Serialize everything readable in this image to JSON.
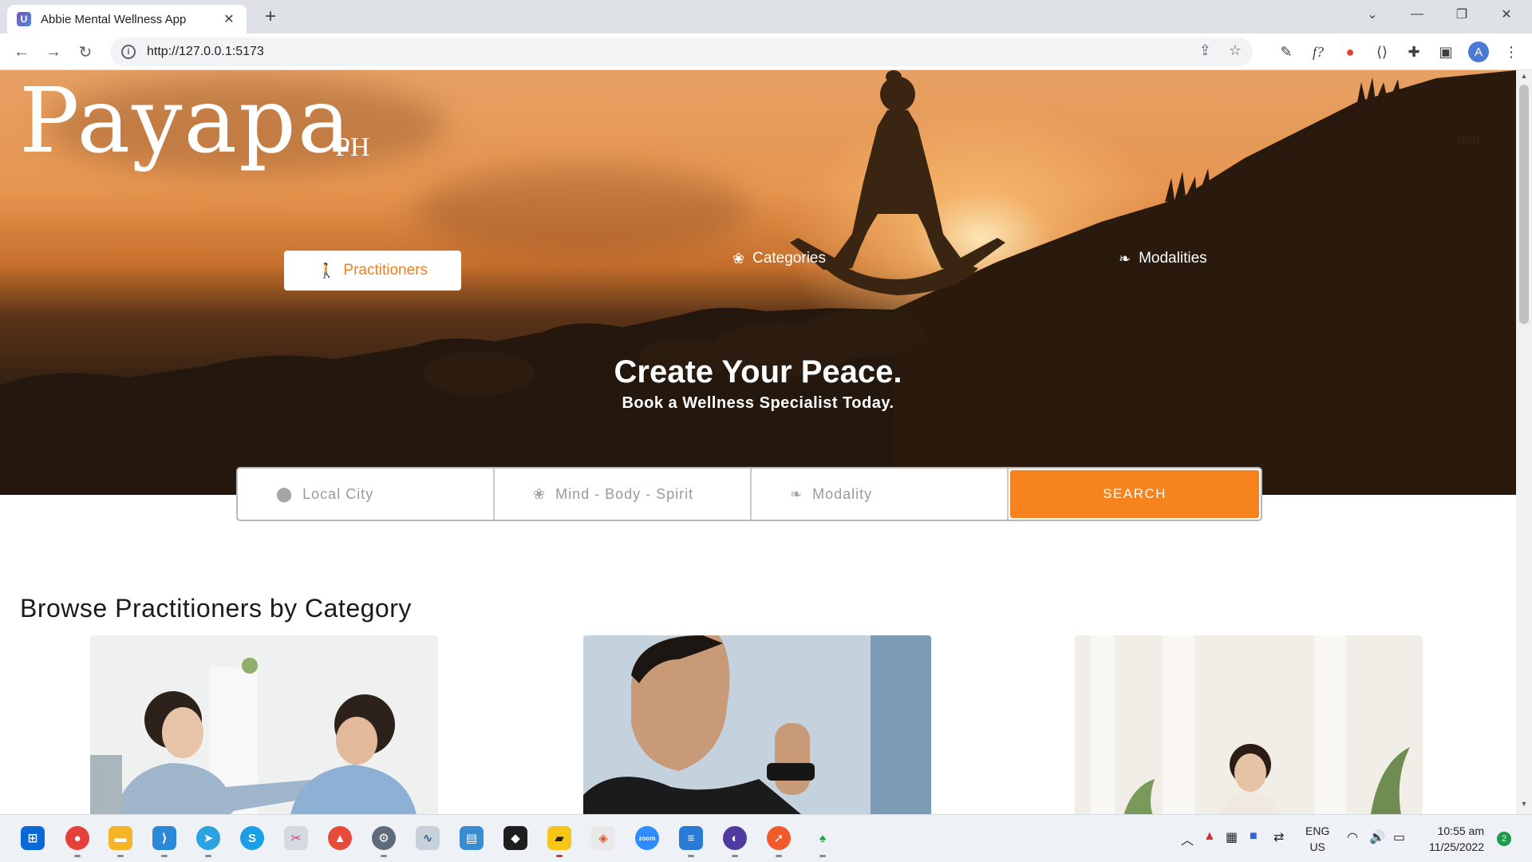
{
  "browser": {
    "tab_title": "Abbie Mental Wellness App",
    "favicon_letter": "U",
    "url": "http://127.0.0.1:5173",
    "profile_initial": "A",
    "extension_f": "f?"
  },
  "site": {
    "logo_main": "Payapa",
    "logo_sub": "PH",
    "test_link": "test",
    "nav": {
      "practitioners": "Practitioners",
      "categories": "Categories",
      "modalities": "Modalities"
    },
    "hero": {
      "title": "Create Your Peace.",
      "subtitle": "Book a Wellness Specialist Today."
    },
    "search": {
      "city_placeholder": "Local City",
      "category_placeholder": "Mind - Body - Spirit",
      "modality_placeholder": "Modality",
      "button": "SEARCH"
    },
    "section_title": "Browse Practitioners by Category"
  },
  "taskbar": {
    "lang_1": "ENG",
    "lang_2": "US",
    "time": "10:55 am",
    "date": "11/25/2022",
    "notifications": "2",
    "zoom_label": "zoom"
  },
  "colors": {
    "accent": "#f7831e",
    "practitioners_text": "#f07f1e"
  }
}
